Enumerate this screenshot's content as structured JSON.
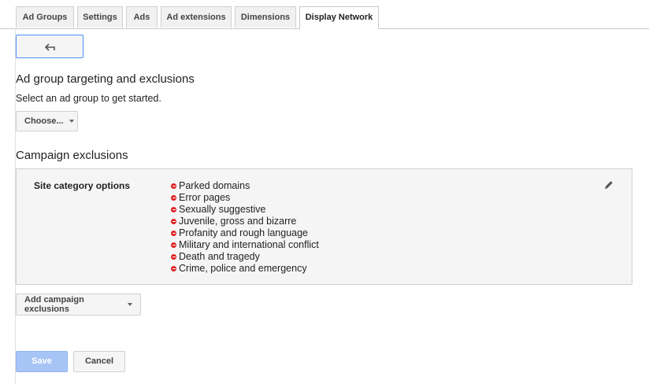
{
  "tabs": [
    {
      "label": "Ad Groups"
    },
    {
      "label": "Settings"
    },
    {
      "label": "Ads"
    },
    {
      "label": "Ad extensions"
    },
    {
      "label": "Dimensions"
    },
    {
      "label": "Display Network",
      "active": true
    }
  ],
  "back_button": {
    "icon": "back-arrow-icon"
  },
  "targeting": {
    "title": "Ad group targeting and exclusions",
    "helper": "Select an ad group to get started.",
    "choose_label": "Choose..."
  },
  "campaign_exclusions": {
    "title": "Campaign exclusions",
    "label": "Site category options",
    "items": [
      "Parked domains",
      "Error pages",
      "Sexually suggestive",
      "Juvenile, gross and bizarre",
      "Profanity and rough language",
      "Military and international conflict",
      "Death and tragedy",
      "Crime, police and emergency"
    ],
    "add_label": "Add campaign exclusions"
  },
  "actions": {
    "save": "Save",
    "cancel": "Cancel"
  },
  "colors": {
    "accent": "#4d90fe",
    "remove": "#dd2222",
    "save_disabled": "#a7c4f7"
  }
}
